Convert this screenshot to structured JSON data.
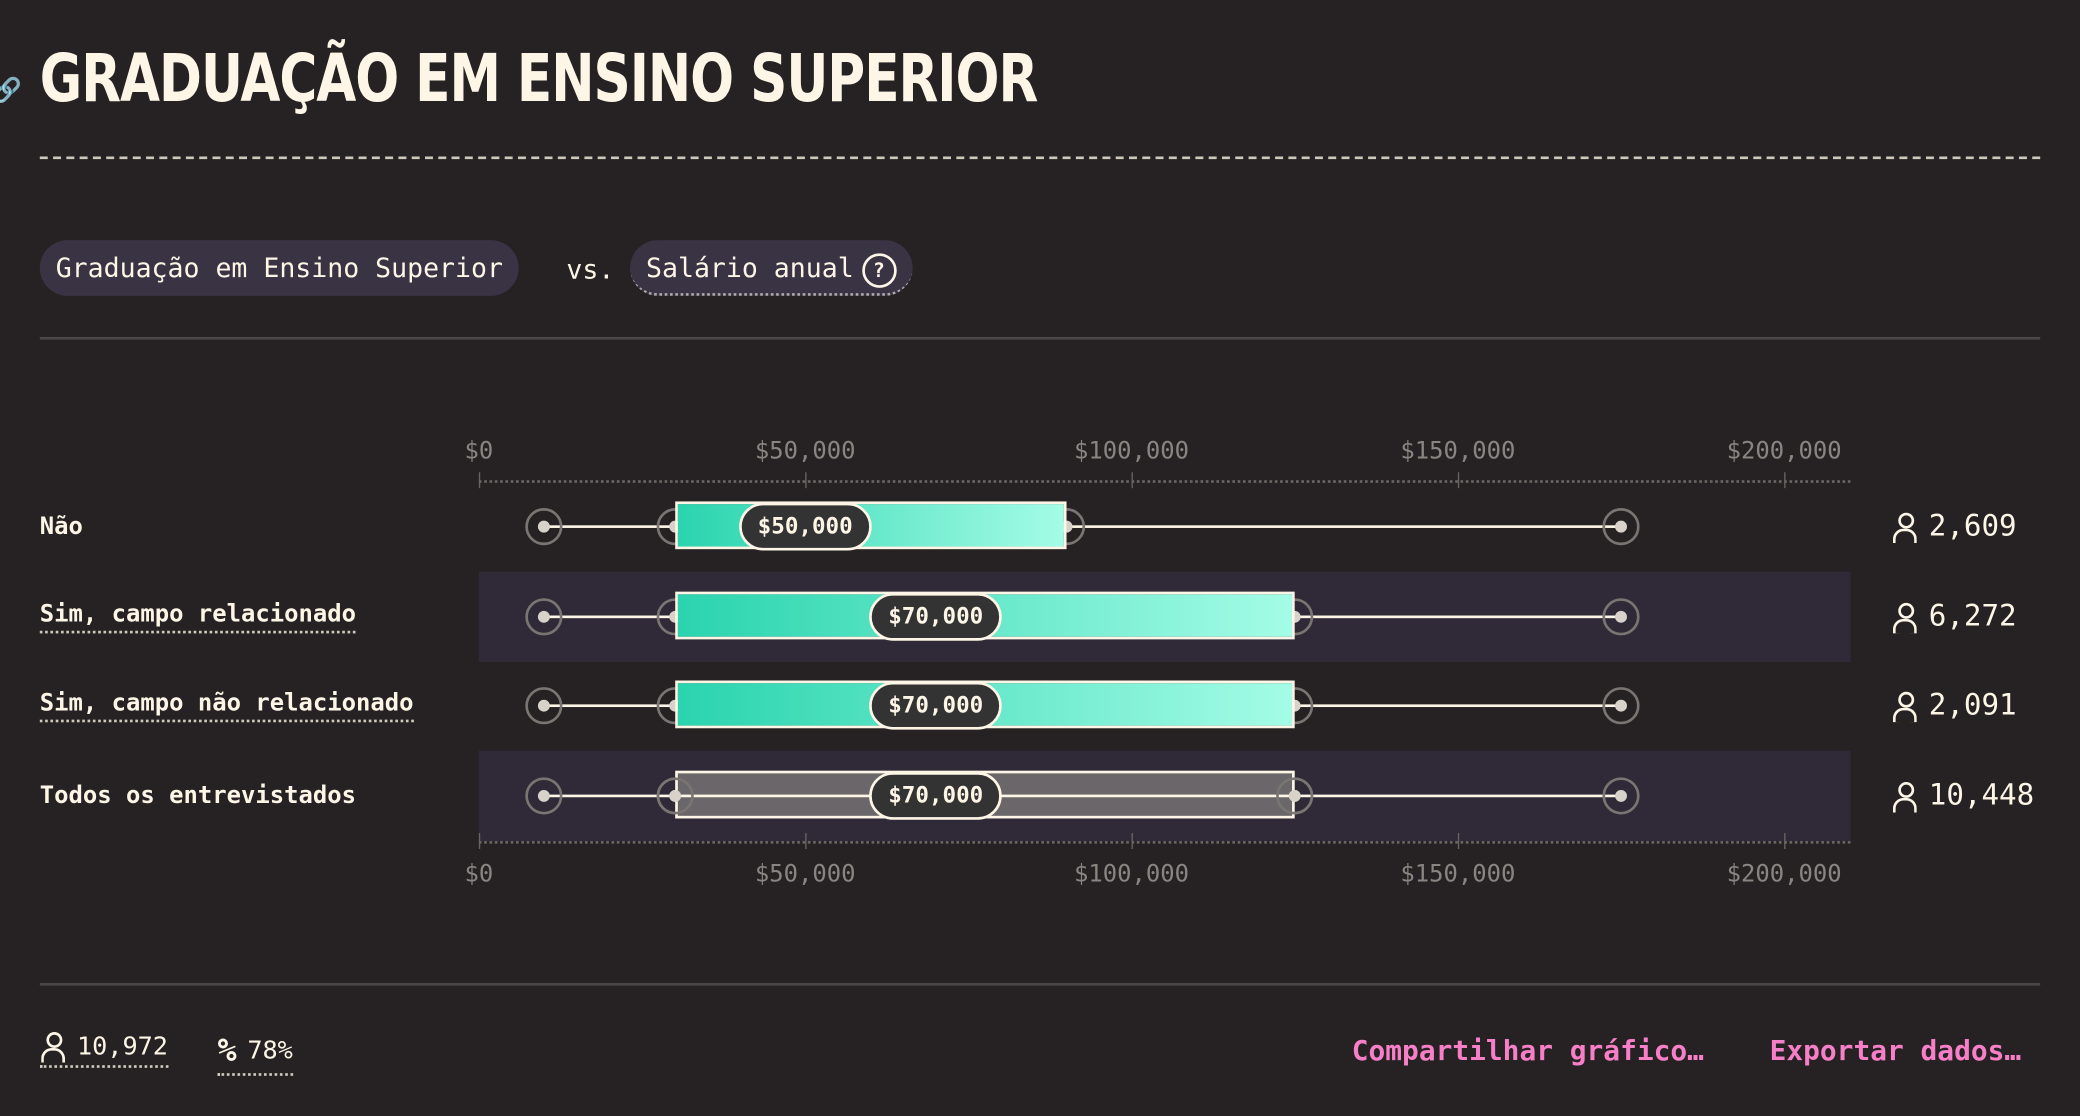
{
  "title": "GRADUAÇÃO EM ENSINO SUPERIOR",
  "selector": {
    "variable": "Graduação em Ensino Superior",
    "vs": "vs.",
    "metric": "Salário anual"
  },
  "chart_data": {
    "type": "boxplot",
    "xlim": [
      0,
      210000
    ],
    "ticks": [
      0,
      50000,
      100000,
      150000,
      200000
    ],
    "tick_labels": [
      "$0",
      "$50,000",
      "$100,000",
      "$150,000",
      "$200,000"
    ],
    "rows": [
      {
        "label": "Não",
        "min": 10000,
        "q1": 30000,
        "median": 50000,
        "q3": 90000,
        "max": 175000,
        "median_label": "$50,000",
        "count": "2,609",
        "highlight": true
      },
      {
        "label": "Sim, campo relacionado",
        "min": 10000,
        "q1": 30000,
        "median": 70000,
        "q3": 125000,
        "max": 175000,
        "median_label": "$70,000",
        "count": "6,272",
        "highlight": true
      },
      {
        "label": "Sim, campo não relacionado",
        "min": 10000,
        "q1": 30000,
        "median": 70000,
        "q3": 125000,
        "max": 175000,
        "median_label": "$70,000",
        "count": "2,091",
        "highlight": true
      },
      {
        "label": "Todos os entrevistados",
        "min": 10000,
        "q1": 30000,
        "median": 70000,
        "q3": 125000,
        "max": 175000,
        "median_label": "$70,000",
        "count": "10,448",
        "highlight": false
      }
    ]
  },
  "footer": {
    "respondents": "10,972",
    "percent": "78%",
    "share": "Compartilhar gráfico…",
    "export": "Exportar dados…"
  },
  "colors": {
    "accent": "#f77fc8",
    "bar_start": "#2ad4ae",
    "bar_end": "#a4fce6"
  }
}
